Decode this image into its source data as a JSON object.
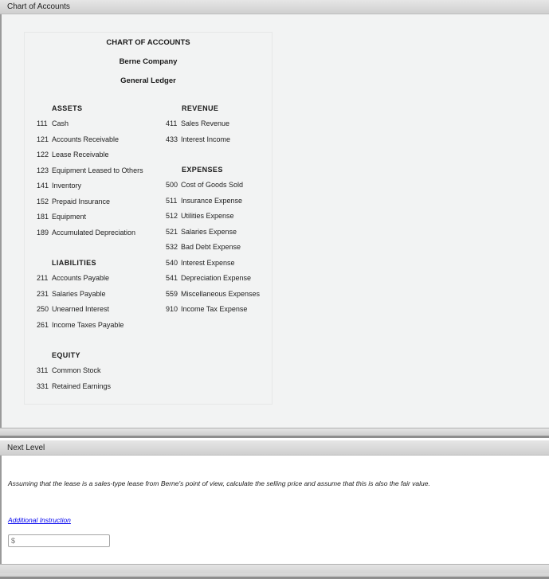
{
  "panels": {
    "chart_panel_title": "Chart of Accounts",
    "next_panel_title": "Next Level"
  },
  "coa": {
    "title": "CHART OF ACCOUNTS",
    "company": "Berne Company",
    "ledger": "General Ledger",
    "assets": {
      "heading": "ASSETS",
      "items": [
        {
          "num": "111",
          "name": "Cash"
        },
        {
          "num": "121",
          "name": "Accounts Receivable"
        },
        {
          "num": "122",
          "name": "Lease Receivable"
        },
        {
          "num": "123",
          "name": "Equipment Leased to Others"
        },
        {
          "num": "141",
          "name": "Inventory"
        },
        {
          "num": "152",
          "name": "Prepaid Insurance"
        },
        {
          "num": "181",
          "name": "Equipment"
        },
        {
          "num": "189",
          "name": "Accumulated Depreciation"
        }
      ]
    },
    "liabilities": {
      "heading": "LIABILITIES",
      "items": [
        {
          "num": "211",
          "name": "Accounts Payable"
        },
        {
          "num": "231",
          "name": "Salaries Payable"
        },
        {
          "num": "250",
          "name": "Unearned Interest"
        },
        {
          "num": "261",
          "name": "Income Taxes Payable"
        }
      ]
    },
    "equity": {
      "heading": "EQUITY",
      "items": [
        {
          "num": "311",
          "name": "Common Stock"
        },
        {
          "num": "331",
          "name": "Retained Earnings"
        }
      ]
    },
    "revenue": {
      "heading": "REVENUE",
      "items": [
        {
          "num": "411",
          "name": "Sales Revenue"
        },
        {
          "num": "433",
          "name": "Interest Income"
        }
      ]
    },
    "expenses": {
      "heading": "EXPENSES",
      "items": [
        {
          "num": "500",
          "name": "Cost of Goods Sold"
        },
        {
          "num": "511",
          "name": "Insurance Expense"
        },
        {
          "num": "512",
          "name": "Utilities Expense"
        },
        {
          "num": "521",
          "name": "Salaries Expense"
        },
        {
          "num": "532",
          "name": "Bad Debt Expense"
        },
        {
          "num": "540",
          "name": "Interest Expense"
        },
        {
          "num": "541",
          "name": "Depreciation Expense"
        },
        {
          "num": "559",
          "name": "Miscellaneous Expenses"
        },
        {
          "num": "910",
          "name": "Income Tax Expense"
        }
      ]
    }
  },
  "next_level": {
    "question": "Assuming that the lease is a sales-type lease from Berne's point of view, calculate the selling price and assume that this is also the fair value.",
    "additional_instruction_link": "Additional Instruction",
    "amount_input": {
      "placeholder": "$",
      "value": ""
    }
  }
}
